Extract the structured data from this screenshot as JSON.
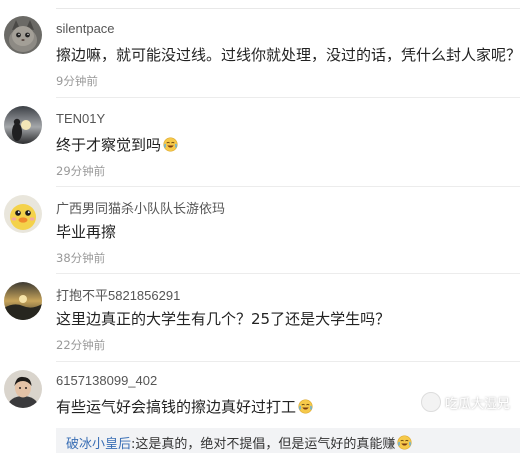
{
  "comments": [
    {
      "username": "silentpace",
      "text": "擦边嘛，就可能没过线。过线你就处理，没过的话，凭什么封人家呢？",
      "time": "9分钟前",
      "avatar": "cat-avatar",
      "emoji": ""
    },
    {
      "username": "TEN01Y",
      "text": "终于才察觉到吗",
      "time": "29分钟前",
      "avatar": "sunset-avatar",
      "emoji": "laugh-cry-emoji"
    },
    {
      "username": "广西男同猫杀小队队长游依玛",
      "text": "毕业再擦",
      "time": "38分钟前",
      "avatar": "duck-avatar",
      "emoji": ""
    },
    {
      "username": "打抱不平5821856291",
      "text": "这里边真正的大学生有几个？25了还是大学生吗？",
      "time": "22分钟前",
      "avatar": "landscape-avatar",
      "emoji": ""
    },
    {
      "username": "6157138099_402",
      "text": "有些运气好会搞钱的擦边真好过打工",
      "time": "",
      "avatar": "person-avatar",
      "emoji": "laugh-cry-emoji"
    }
  ],
  "reply": {
    "user": "破冰小皇后",
    "text": ":这是真的，绝对不提倡，但是运气好的真能赚",
    "emoji": "laugh-cry-emoji"
  },
  "watermark": {
    "text": "吃瓜大湿兄",
    "icon": "watermark-logo-icon"
  },
  "colors": {
    "username": "#555555",
    "time": "#999999",
    "reply_user": "#3a6fb5",
    "reply_bg": "#f2f3f5"
  }
}
